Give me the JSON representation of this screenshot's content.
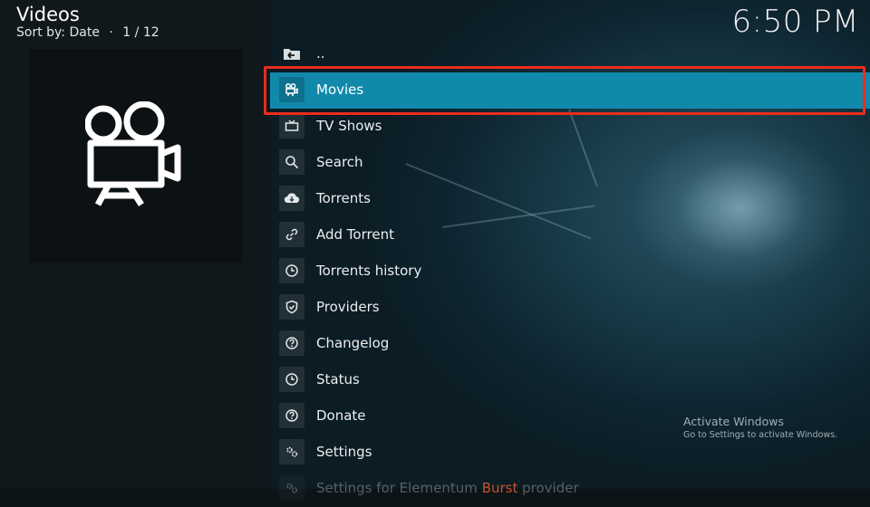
{
  "header": {
    "title": "Videos",
    "sort_prefix": "Sort by: Date",
    "separator": "·",
    "page_counter": "1 / 12"
  },
  "clock": "6:50 PM",
  "thumbnail": {
    "icon": "movie-camera-icon"
  },
  "list": {
    "items": [
      {
        "label": "..",
        "icon": "folder-back-icon"
      },
      {
        "label": "Movies",
        "icon": "film-camera-icon",
        "selected": true
      },
      {
        "label": "TV Shows",
        "icon": "tv-icon"
      },
      {
        "label": "Search",
        "icon": "search-icon"
      },
      {
        "label": "Torrents",
        "icon": "cloud-download-icon"
      },
      {
        "label": "Add Torrent",
        "icon": "link-icon"
      },
      {
        "label": "Torrents history",
        "icon": "clock-icon"
      },
      {
        "label": "Providers",
        "icon": "shield-icon"
      },
      {
        "label": "Changelog",
        "icon": "question-icon"
      },
      {
        "label": "Status",
        "icon": "clock-icon"
      },
      {
        "label": "Donate",
        "icon": "question-icon"
      },
      {
        "label": "Settings",
        "icon": "gears-icon"
      },
      {
        "label_pre": "Settings for Elementum ",
        "label_accent": "Burst",
        "label_post": " provider",
        "icon": "gears-icon"
      }
    ]
  },
  "watermark": {
    "line1": "Activate Windows",
    "line2": "Go to Settings to activate Windows."
  },
  "colors": {
    "selected_bg": "#1189ab",
    "highlight_border": "#ea2d1d",
    "accent_text": "#c8522e"
  }
}
